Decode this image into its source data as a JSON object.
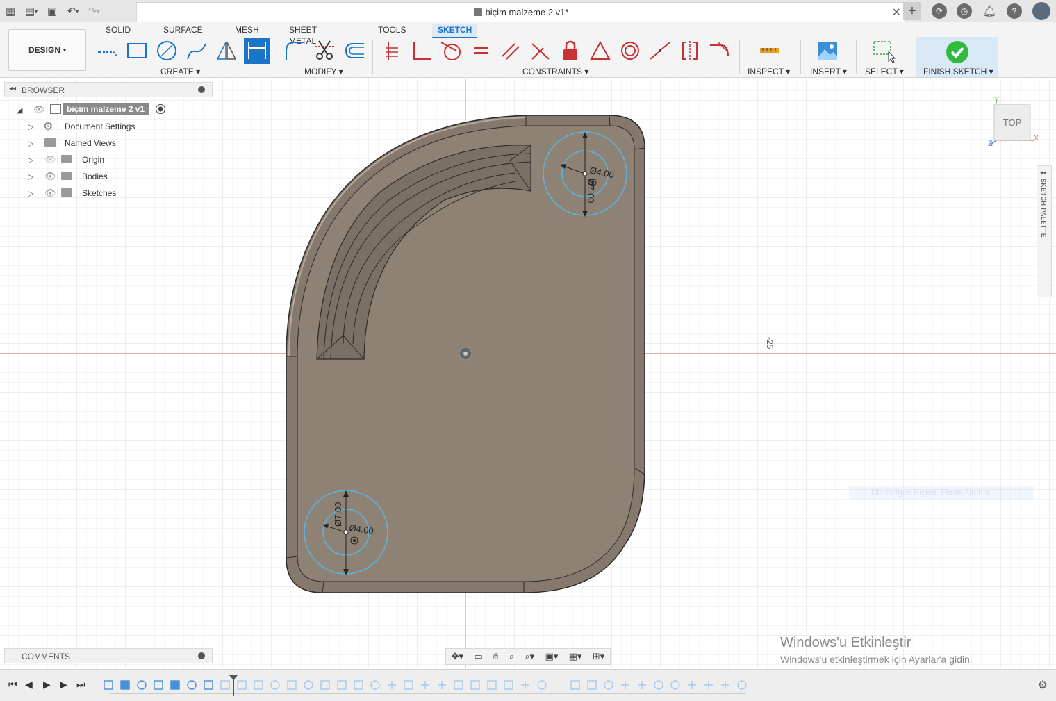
{
  "window": {
    "doc_title": "biçim malzeme 2 v1*"
  },
  "ribbon": {
    "design_label": "DESIGN",
    "tabs": [
      {
        "label": "SOLID"
      },
      {
        "label": "SURFACE"
      },
      {
        "label": "MESH"
      },
      {
        "label": "SHEET METAL"
      },
      {
        "label": "TOOLS"
      },
      {
        "label": "SKETCH",
        "active": true
      }
    ],
    "groups": {
      "create": "CREATE",
      "modify": "MODIFY",
      "constraints": "CONSTRAINTS",
      "inspect": "INSPECT",
      "insert": "INSERT",
      "select": "SELECT",
      "finish": "FINISH SKETCH"
    }
  },
  "browser": {
    "title": "BROWSER",
    "root": "biçim malzeme 2 v1",
    "items": [
      {
        "label": "Document Settings",
        "icon": "gear-icon"
      },
      {
        "label": "Named Views",
        "icon": "folder-icon"
      },
      {
        "label": "Origin",
        "icon": "folder-icon"
      },
      {
        "label": "Bodies",
        "icon": "folder-icon"
      },
      {
        "label": "Sketches",
        "icon": "folder-icon"
      }
    ]
  },
  "comments": {
    "title": "COMMENTS"
  },
  "sketch_palette": {
    "title": "SKETCH PALETTE"
  },
  "viewcube": {
    "face": "TOP",
    "axis_x": "X",
    "axis_y": "Y",
    "axis_z": "Z"
  },
  "viewport": {
    "axis_marker": "-25",
    "dims": {
      "top_inner": "Ø4.00",
      "top_outer": "Ø7.00",
      "bottom_inner": "Ø4.00",
      "bottom_outer": "Ø7.00"
    },
    "ghost_tooltip": "Dikdörtgen Biçimli Ekran Alıntısı"
  },
  "watermark": {
    "line1": "Windows'u Etkinleştir",
    "line2": "Windows'u etkinleştirmek için Ayarlar'a gidin."
  },
  "colors": {
    "accent": "#1a74c8",
    "body_fill": "#85786c",
    "sketch_circle": "#5ab4e6",
    "axis_red": "#e07070",
    "axis_green": "#6fc06f",
    "finish_check": "#2fbb3e"
  }
}
